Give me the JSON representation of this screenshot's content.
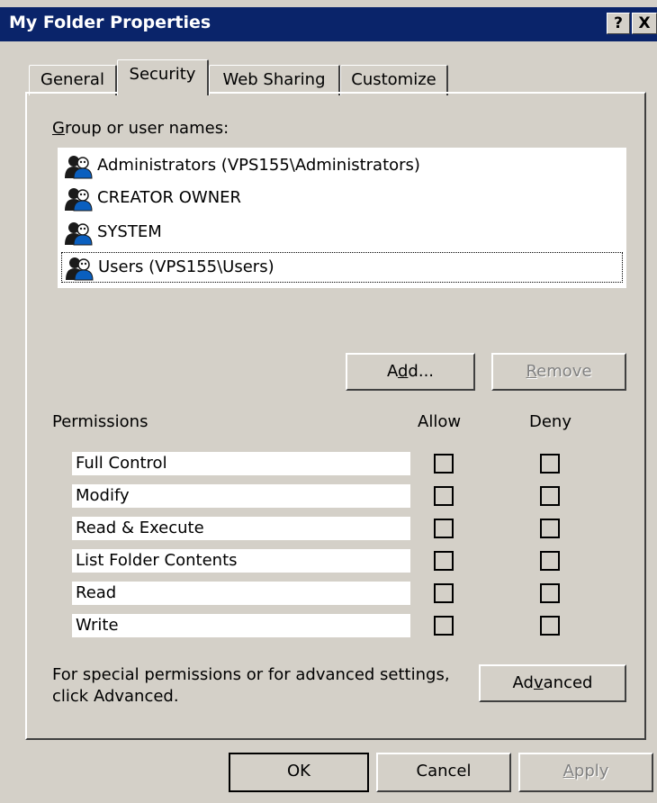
{
  "window": {
    "title": "My Folder Properties",
    "help_glyph": "?",
    "close_glyph": "X"
  },
  "tabs": [
    {
      "label": "General",
      "active": false
    },
    {
      "label": "Security",
      "active": true
    },
    {
      "label": "Web Sharing",
      "active": false
    },
    {
      "label": "Customize",
      "active": false
    }
  ],
  "group_label": {
    "mnemonic": "G",
    "rest": "roup or user names:"
  },
  "users": [
    {
      "name": "Administrators (VPS155\\Administrators)",
      "icon": "user-group-icon"
    },
    {
      "name": "CREATOR OWNER",
      "icon": "user-group-icon"
    },
    {
      "name": "SYSTEM",
      "icon": "user-group-icon"
    },
    {
      "name": "Users (VPS155\\Users)",
      "icon": "user-group-icon",
      "focused": true
    }
  ],
  "buttons": {
    "add": {
      "pre": "A",
      "mnemonic": "d",
      "post": "d..."
    },
    "remove": {
      "pre": "",
      "mnemonic": "R",
      "post": "emove",
      "enabled": false
    },
    "advanced": {
      "pre": "Ad",
      "mnemonic": "v",
      "post": "anced"
    },
    "ok": "OK",
    "cancel": "Cancel",
    "apply": {
      "pre": "",
      "mnemonic": "A",
      "post": "pply",
      "enabled": false
    }
  },
  "permissions": {
    "header": "Permissions",
    "allow": "Allow",
    "deny": "Deny",
    "rows": [
      {
        "name": "Full Control",
        "allow": false,
        "deny": false
      },
      {
        "name": "Modify",
        "allow": false,
        "deny": false
      },
      {
        "name": "Read & Execute",
        "allow": false,
        "deny": false
      },
      {
        "name": "List Folder Contents",
        "allow": false,
        "deny": false
      },
      {
        "name": "Read",
        "allow": false,
        "deny": false
      },
      {
        "name": "Write",
        "allow": false,
        "deny": false
      }
    ]
  },
  "special_text_line1": "For special permissions or for advanced settings,",
  "special_text_line2": "click Advanced.",
  "colors": {
    "titlebar": "#0a246a",
    "face": "#d4d0c8",
    "list_bg": "#ffffff",
    "disabled_text": "#808080"
  }
}
